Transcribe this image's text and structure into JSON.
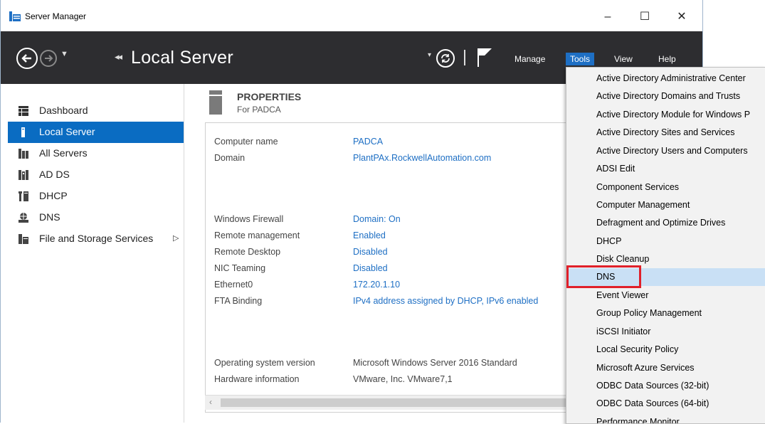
{
  "window": {
    "title": "Server Manager",
    "controls": {
      "minimize": "–",
      "maximize": "☐",
      "close": "✕"
    }
  },
  "header": {
    "page_title": "Local Server",
    "breadcrumb_chevron": "◂◂",
    "menu": {
      "manage": "Manage",
      "tools": "Tools",
      "view": "View",
      "help": "Help"
    }
  },
  "sidebar": {
    "items": [
      {
        "label": "Dashboard",
        "icon": "dashboard-icon"
      },
      {
        "label": "Local Server",
        "icon": "server-icon",
        "selected": true
      },
      {
        "label": "All Servers",
        "icon": "servers-icon"
      },
      {
        "label": "AD DS",
        "icon": "adds-icon"
      },
      {
        "label": "DHCP",
        "icon": "dhcp-icon"
      },
      {
        "label": "DNS",
        "icon": "dns-icon"
      },
      {
        "label": "File and Storage Services",
        "icon": "storage-icon",
        "has_submenu": true
      }
    ]
  },
  "properties": {
    "title": "PROPERTIES",
    "subtitle": "For PADCA",
    "rows": [
      {
        "key": "Computer name",
        "value": "PADCA"
      },
      {
        "key": "Domain",
        "value": "PlantPAx.RockwellAutomation.com"
      },
      {
        "key": "Windows Firewall",
        "value": "Domain: On"
      },
      {
        "key": "Remote management",
        "value": "Enabled"
      },
      {
        "key": "Remote Desktop",
        "value": "Disabled"
      },
      {
        "key": "NIC Teaming",
        "value": "Disabled"
      },
      {
        "key": "Ethernet0",
        "value": "172.20.1.10"
      },
      {
        "key": "FTA Binding",
        "value": "IPv4 address assigned by DHCP, IPv6 enabled"
      },
      {
        "key": "Operating system version",
        "value": "Microsoft Windows Server 2016 Standard"
      },
      {
        "key": "Hardware information",
        "value": "VMware, Inc. VMware7,1"
      }
    ]
  },
  "tools_menu": {
    "items": [
      "Active Directory Administrative Center",
      "Active Directory Domains and Trusts",
      "Active Directory Module for Windows P",
      "Active Directory Sites and Services",
      "Active Directory Users and Computers",
      "ADSI Edit",
      "Component Services",
      "Computer Management",
      "Defragment and Optimize Drives",
      "DHCP",
      "Disk Cleanup",
      "DNS",
      "Event Viewer",
      "Group Policy Management",
      "iSCSI Initiator",
      "Local Security Policy",
      "Microsoft Azure Services",
      "ODBC Data Sources (32-bit)",
      "ODBC Data Sources (64-bit)",
      "Performance Monitor"
    ],
    "highlighted": "DNS"
  },
  "colors": {
    "header_bg": "#2d2d30",
    "accent": "#0a6cc2",
    "link": "#1e6fc4",
    "highlight_border": "#e0202a",
    "menu_hover": "#c9e0f5"
  }
}
